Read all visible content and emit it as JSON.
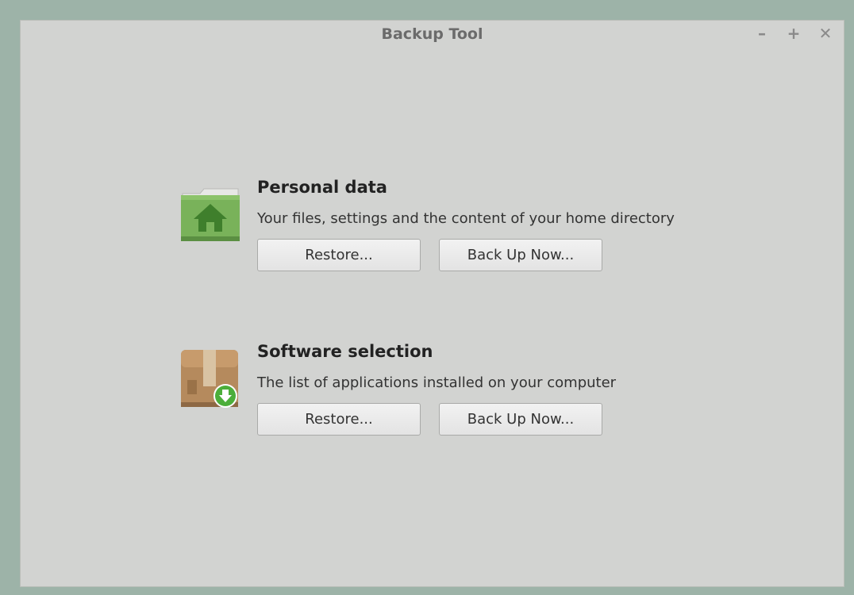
{
  "window": {
    "title": "Backup Tool",
    "controls": {
      "minimize": "–",
      "maximize": "+",
      "close": "✕"
    }
  },
  "sections": {
    "personal": {
      "heading": "Personal data",
      "description": "Your files, settings and the content of your home directory",
      "restore_label": "Restore...",
      "backup_label": "Back Up Now...",
      "icon": "home-folder-icon"
    },
    "software": {
      "heading": "Software selection",
      "description": "The list of applications installed on your computer",
      "restore_label": "Restore...",
      "backup_label": "Back Up Now...",
      "icon": "package-download-icon"
    }
  },
  "colors": {
    "window_bg": "#d2d3d1",
    "desktop_bg": "#9db3a8",
    "folder_green": "#6ea84d",
    "box_brown": "#b2865a",
    "download_green": "#4cae3a"
  }
}
